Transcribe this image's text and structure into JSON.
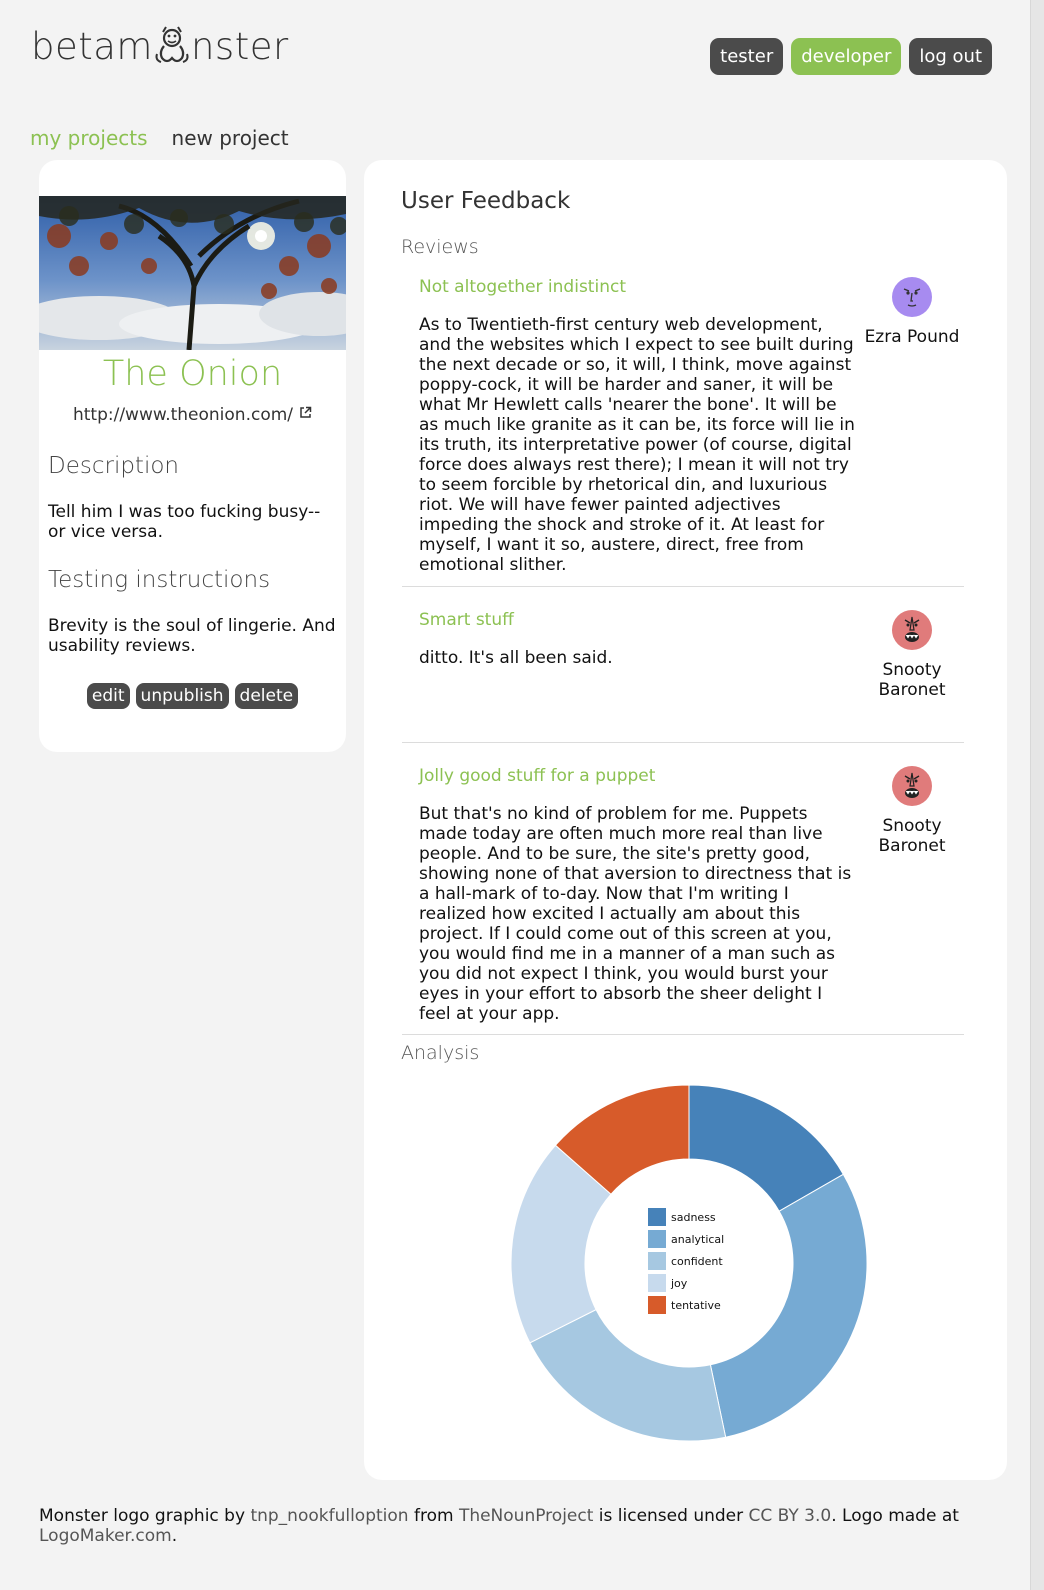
{
  "header": {
    "logo_text": "betamonster",
    "logo_prefix": "betam",
    "logo_suffix": "nster",
    "buttons": [
      {
        "label": "tester"
      },
      {
        "label": "developer"
      },
      {
        "label": "log out"
      }
    ]
  },
  "subnav": {
    "my_projects": "my projects",
    "new_project": "new project"
  },
  "project": {
    "title": "The Onion",
    "url": "http://www.theonion.com/",
    "description_heading": "Description",
    "description": "Tell him I was too fucking busy-- or vice versa.",
    "instructions_heading": "Testing instructions",
    "instructions": "Brevity is the soul of lingerie. And usability reviews.",
    "actions": {
      "edit": "edit",
      "unpublish": "unpublish",
      "delete": "delete"
    }
  },
  "feedback": {
    "heading": "User Feedback",
    "reviews_heading": "Reviews",
    "reviews": [
      {
        "title": "Not altogether indistinct",
        "text": "As to Twentieth-first century web development, and the websites which I expect to see built during the next decade or so, it will, I think, move against poppy-cock, it will be harder and saner, it will be what Mr Hewlett calls 'nearer the bone'. It will be as much like granite as it can be, its force will lie in its truth, its interpretative power (of course, digital force does always rest there); I mean it will not try to seem forcible by rhetorical din, and luxurious riot. We will have fewer painted adjectives impeding the shock and stroke of it. At least for myself, I want it so, austere, direct, free from emotional slither.",
        "reviewer": "Ezra Pound",
        "avatar_color": "#a78bf0"
      },
      {
        "title": "Smart stuff",
        "text": "ditto. It's all been said.",
        "reviewer": "Snooty Baronet",
        "avatar_color": "#e07b7b"
      },
      {
        "title": "Jolly good stuff for a puppet",
        "text": "But that's no kind of problem for me. Puppets made today are often much more real than live people. And to be sure, the site's pretty good, showing none of that aversion to directness that is a hall-mark of to-day. Now that I'm writing I realized how excited I actually am about this project. If I could come out of this screen at you, you would find me in a manner of a man such as you did not expect I think, you would burst your eyes in your effort to absorb the sheer delight I feel at your app.",
        "reviewer": "Snooty Baronet",
        "avatar_color": "#e07b7b"
      }
    ],
    "analysis_heading": "Analysis"
  },
  "chart_data": {
    "type": "pie",
    "donut": true,
    "categories": [
      "sadness",
      "analytical",
      "confident",
      "joy",
      "tentative"
    ],
    "values": [
      16.7,
      30.0,
      20.9,
      18.9,
      13.5
    ],
    "colors": [
      "#4682b9",
      "#76aad3",
      "#a6c8e1",
      "#c7daed",
      "#d75b2a"
    ],
    "legend_placement": "center"
  },
  "footer": {
    "t1": "Monster logo graphic by ",
    "author": "tnp_nookfulloption",
    "t2": " from ",
    "source": "TheNounProject",
    "t3": " is licensed under ",
    "license": "CC BY 3.0",
    "t4": ". Logo made at ",
    "maker": "LogoMaker.com",
    "t5": "."
  }
}
